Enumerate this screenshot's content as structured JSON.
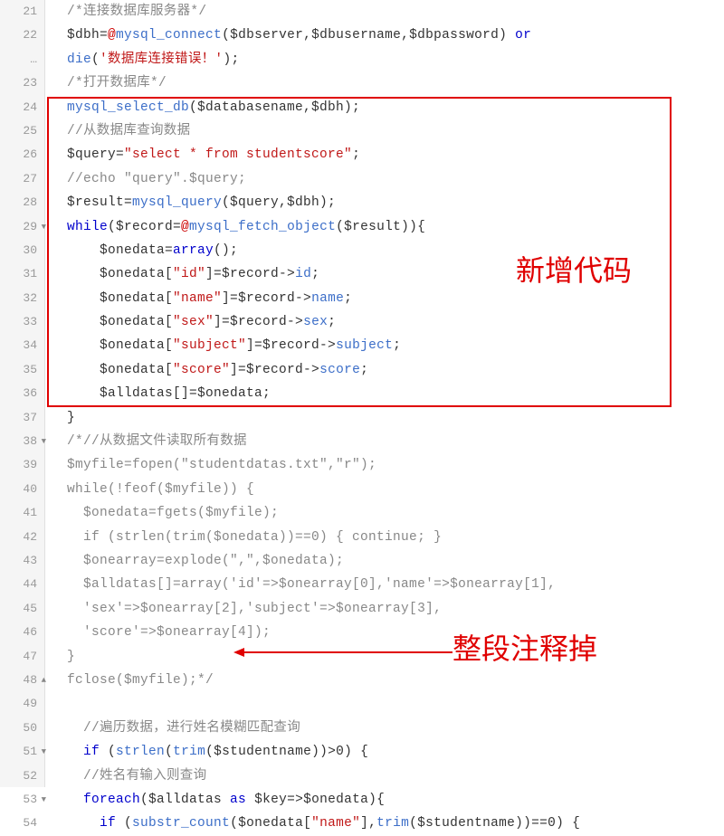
{
  "annotations": {
    "new_code": "新增代码",
    "comment_out": "整段注释掉"
  },
  "gutter": [
    {
      "n": "21"
    },
    {
      "n": "22"
    },
    {
      "n": "…"
    },
    {
      "n": "23"
    },
    {
      "n": "24"
    },
    {
      "n": "25"
    },
    {
      "n": "26"
    },
    {
      "n": "27"
    },
    {
      "n": "28"
    },
    {
      "n": "29",
      "fold": "▼"
    },
    {
      "n": "30"
    },
    {
      "n": "31"
    },
    {
      "n": "32"
    },
    {
      "n": "33"
    },
    {
      "n": "34"
    },
    {
      "n": "35"
    },
    {
      "n": "36"
    },
    {
      "n": "37"
    },
    {
      "n": "38",
      "fold": "▼"
    },
    {
      "n": "39"
    },
    {
      "n": "40"
    },
    {
      "n": "41"
    },
    {
      "n": "42"
    },
    {
      "n": "43"
    },
    {
      "n": "44"
    },
    {
      "n": "45"
    },
    {
      "n": "46"
    },
    {
      "n": "47"
    },
    {
      "n": "48",
      "fold": "▲"
    },
    {
      "n": "49"
    },
    {
      "n": "50"
    },
    {
      "n": "51",
      "fold": "▼"
    },
    {
      "n": "52"
    },
    {
      "n": "53",
      "fold": "▼"
    },
    {
      "n": "54"
    }
  ],
  "lines": [
    [
      {
        "c": "cm",
        "t": "  /*连接数据库服务器*/"
      }
    ],
    [
      {
        "c": "pl",
        "t": "  $dbh="
      },
      {
        "c": "er",
        "t": "@"
      },
      {
        "c": "fn",
        "t": "mysql_connect"
      },
      {
        "c": "pl",
        "t": "($dbserver,$dbusername,$dbpassword) "
      },
      {
        "c": "kw",
        "t": "or"
      }
    ],
    [
      {
        "c": "fn",
        "t": "  die"
      },
      {
        "c": "pl",
        "t": "("
      },
      {
        "c": "st",
        "t": "'数据库连接错误！'"
      },
      {
        "c": "pl",
        "t": ");"
      }
    ],
    [
      {
        "c": "cm",
        "t": "  /*打开数据库*/"
      }
    ],
    [
      {
        "c": "fn",
        "t": "  mysql_select_db"
      },
      {
        "c": "pl",
        "t": "($databasename,$dbh);"
      }
    ],
    [
      {
        "c": "cm",
        "t": "  //从数据库查询数据"
      }
    ],
    [
      {
        "c": "pl",
        "t": "  $query="
      },
      {
        "c": "st",
        "t": "\"select * from studentscore\""
      },
      {
        "c": "pl",
        "t": ";"
      }
    ],
    [
      {
        "c": "cm",
        "t": "  //echo \"query\".$query;"
      }
    ],
    [
      {
        "c": "pl",
        "t": "  $result="
      },
      {
        "c": "fn",
        "t": "mysql_query"
      },
      {
        "c": "pl",
        "t": "($query,$dbh);"
      }
    ],
    [
      {
        "c": "kw",
        "t": "  while"
      },
      {
        "c": "pl",
        "t": "($record="
      },
      {
        "c": "er",
        "t": "@"
      },
      {
        "c": "fn",
        "t": "mysql_fetch_object"
      },
      {
        "c": "pl",
        "t": "($result)){"
      }
    ],
    [
      {
        "c": "pl",
        "t": "      $onedata="
      },
      {
        "c": "kw",
        "t": "array"
      },
      {
        "c": "pl",
        "t": "();"
      }
    ],
    [
      {
        "c": "pl",
        "t": "      $onedata["
      },
      {
        "c": "st",
        "t": "\"id\""
      },
      {
        "c": "pl",
        "t": "]=$record->"
      },
      {
        "c": "fn",
        "t": "id"
      },
      {
        "c": "pl",
        "t": ";"
      }
    ],
    [
      {
        "c": "pl",
        "t": "      $onedata["
      },
      {
        "c": "st",
        "t": "\"name\""
      },
      {
        "c": "pl",
        "t": "]=$record->"
      },
      {
        "c": "fn",
        "t": "name"
      },
      {
        "c": "pl",
        "t": ";"
      }
    ],
    [
      {
        "c": "pl",
        "t": "      $onedata["
      },
      {
        "c": "st",
        "t": "\"sex\""
      },
      {
        "c": "pl",
        "t": "]=$record->"
      },
      {
        "c": "fn",
        "t": "sex"
      },
      {
        "c": "pl",
        "t": ";"
      }
    ],
    [
      {
        "c": "pl",
        "t": "      $onedata["
      },
      {
        "c": "st",
        "t": "\"subject\""
      },
      {
        "c": "pl",
        "t": "]=$record->"
      },
      {
        "c": "fn",
        "t": "subject"
      },
      {
        "c": "pl",
        "t": ";"
      }
    ],
    [
      {
        "c": "pl",
        "t": "      $onedata["
      },
      {
        "c": "st",
        "t": "\"score\""
      },
      {
        "c": "pl",
        "t": "]=$record->"
      },
      {
        "c": "fn",
        "t": "score"
      },
      {
        "c": "pl",
        "t": ";"
      }
    ],
    [
      {
        "c": "pl",
        "t": "      $alldatas[]=$onedata;"
      }
    ],
    [
      {
        "c": "pl",
        "t": "  }"
      }
    ],
    [
      {
        "c": "cm",
        "t": "  /*//从数据文件读取所有数据"
      }
    ],
    [
      {
        "c": "cm",
        "t": "  $myfile=fopen(\"studentdatas.txt\",\"r\");"
      }
    ],
    [
      {
        "c": "cm",
        "t": "  while(!feof($myfile)) {"
      }
    ],
    [
      {
        "c": "cm",
        "t": "    $onedata=fgets($myfile);"
      }
    ],
    [
      {
        "c": "cm",
        "t": "    if (strlen(trim($onedata))==0) { continue; }"
      }
    ],
    [
      {
        "c": "cm",
        "t": "    $onearray=explode(\",\",$onedata);"
      }
    ],
    [
      {
        "c": "cm",
        "t": "    $alldatas[]=array('id'=>$onearray[0],'name'=>$onearray[1],"
      }
    ],
    [
      {
        "c": "cm",
        "t": "    'sex'=>$onearray[2],'subject'=>$onearray[3],"
      }
    ],
    [
      {
        "c": "cm",
        "t": "    'score'=>$onearray[4]);"
      }
    ],
    [
      {
        "c": "cm",
        "t": "  }"
      }
    ],
    [
      {
        "c": "cm",
        "t": "  fclose($myfile);*/"
      }
    ],
    [
      {
        "c": "pl",
        "t": ""
      }
    ],
    [
      {
        "c": "cm",
        "t": "    //遍历数据，进行姓名模糊匹配查询"
      }
    ],
    [
      {
        "c": "pl",
        "t": "    "
      },
      {
        "c": "kw",
        "t": "if"
      },
      {
        "c": "pl",
        "t": " ("
      },
      {
        "c": "fn",
        "t": "strlen"
      },
      {
        "c": "pl",
        "t": "("
      },
      {
        "c": "fn",
        "t": "trim"
      },
      {
        "c": "pl",
        "t": "($studentname))>0) {"
      }
    ],
    [
      {
        "c": "cm",
        "t": "    //姓名有输入则查询"
      }
    ],
    [
      {
        "c": "pl",
        "t": "    "
      },
      {
        "c": "kw",
        "t": "foreach"
      },
      {
        "c": "pl",
        "t": "($alldatas "
      },
      {
        "c": "kw",
        "t": "as"
      },
      {
        "c": "pl",
        "t": " $key=>$onedata){"
      }
    ],
    [
      {
        "c": "pl",
        "t": "      "
      },
      {
        "c": "kw",
        "t": "if"
      },
      {
        "c": "pl",
        "t": " ("
      },
      {
        "c": "fn",
        "t": "substr_count"
      },
      {
        "c": "pl",
        "t": "($onedata["
      },
      {
        "c": "st",
        "t": "\"name\""
      },
      {
        "c": "pl",
        "t": "],"
      },
      {
        "c": "fn",
        "t": "trim"
      },
      {
        "c": "pl",
        "t": "($studentname))==0) {"
      }
    ]
  ]
}
